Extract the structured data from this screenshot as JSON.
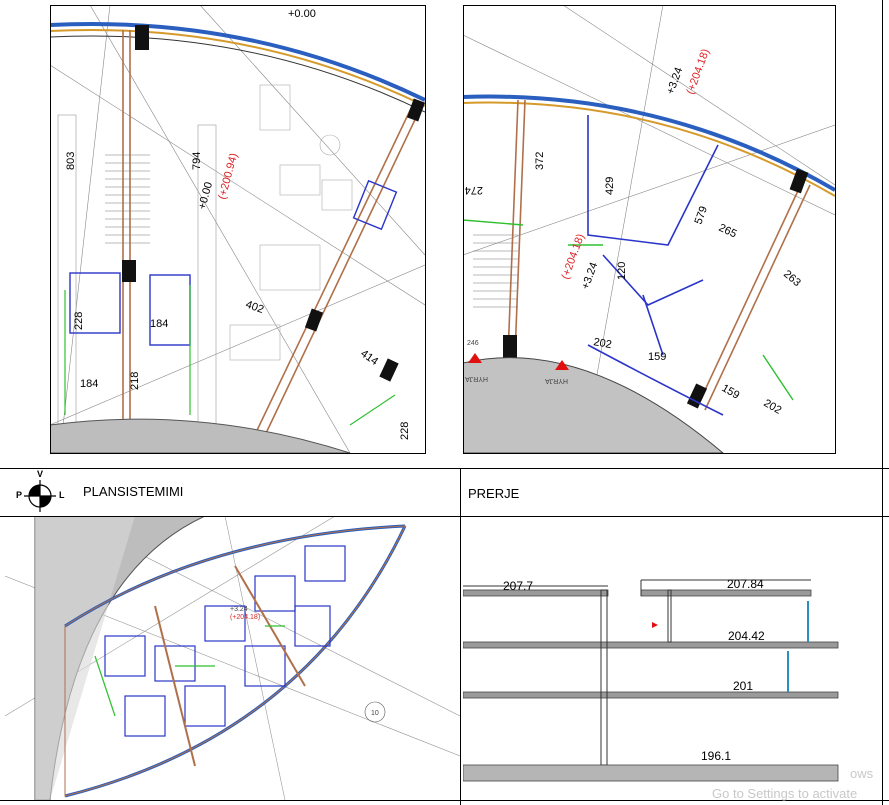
{
  "plan_title": "PLANSISTEMIMI",
  "section_title": "PRERJE",
  "compass": {
    "top": "V",
    "left": "P",
    "right": "L"
  },
  "top_left_dims": [
    "803",
    "794",
    "228",
    "184",
    "184",
    "218",
    "402",
    "414",
    "228"
  ],
  "top_left_levels": [
    "+0.00",
    "(+200.94)",
    "+0.00"
  ],
  "top_right_dims": [
    "372",
    "274",
    "429",
    "120",
    "579",
    "265",
    "263",
    "202",
    "159",
    "159",
    "202",
    "246"
  ],
  "top_right_levels": [
    "+3.24",
    "(+204.18)",
    "+3.24",
    "(+204.18)"
  ],
  "top_right_labels": [
    "HYRJA",
    "HYRJA"
  ],
  "plan_levels": [
    "+3.24",
    "(+204.18)"
  ],
  "plan_marker": "10",
  "section_levels": {
    "a": "207.7",
    "b": "207.84",
    "c": "204.42",
    "d": "201",
    "e": "196.1"
  },
  "watermark_lines": [
    "ows",
    "Go to Settings to activate"
  ],
  "colors": {
    "wall": "#b0704a",
    "partition": "#2a35c9",
    "glass": "#3a6fc9",
    "green": "#2ec02e",
    "grey": "#bdbdbd",
    "red": "#e01010"
  }
}
